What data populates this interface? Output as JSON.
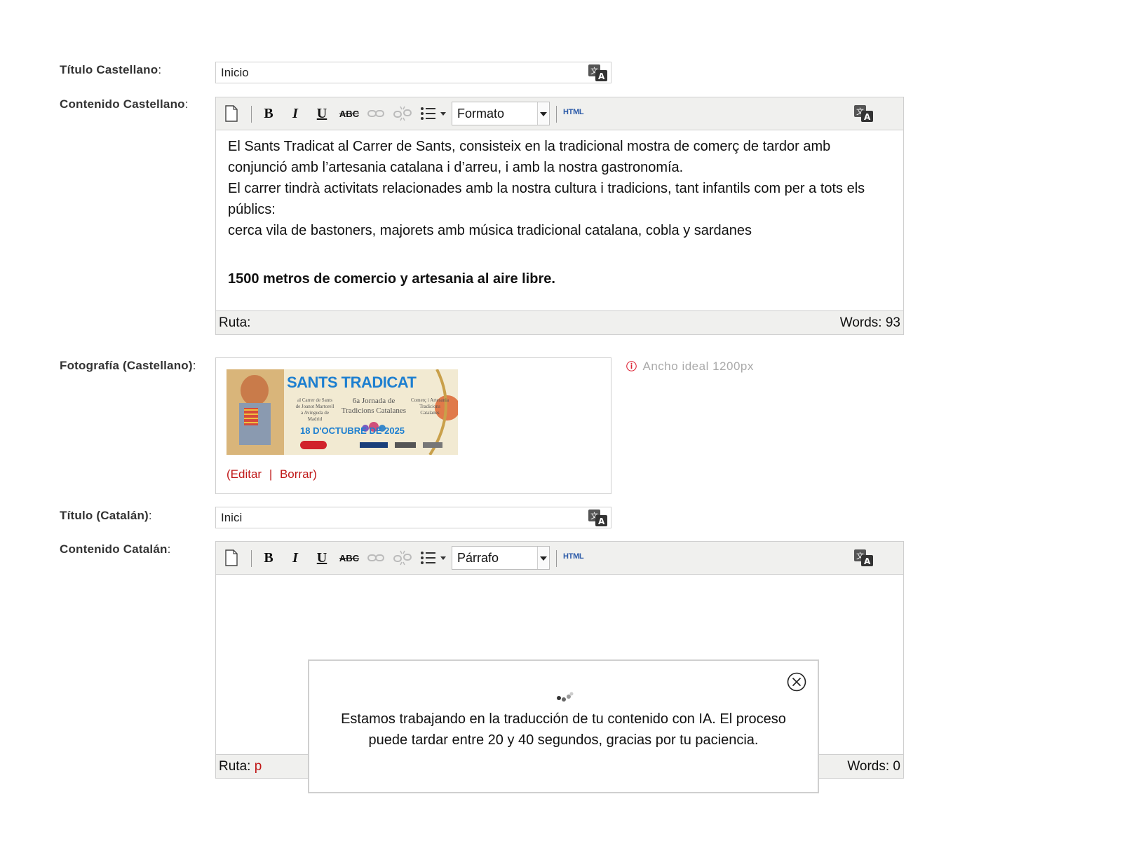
{
  "fields": {
    "titulo_castellano": {
      "label": "Título Castellano",
      "value": "Inicio"
    },
    "contenido_castellano": {
      "label": "Contenido Castellano",
      "format": "Formato",
      "paragraphs": [
        "El Sants Tradicat  al Carrer de Sants, consisteix en la tradicional mostra de comerç de tardor amb conjunció amb l’artesania catalana i d’arreu, i amb la nostra gastronomía.",
        "El carrer tindrà activitats relacionades amb la nostra cultura i tradicions, tant infantils com per a tots els públics:",
        "cerca vila de bastoners,  majorets amb música tradicional catalana, cobla y sardanes"
      ],
      "bold_line": "1500 metros de comercio y artesania al aire libre.",
      "ruta": "Ruta:",
      "words": "Words: 93"
    },
    "fotografia": {
      "label": "Fotografía (Castellano)",
      "banner": {
        "title": "SANTS TRADICAT",
        "left_text": [
          "al Carrer de Sants",
          "de Joanot Martorell",
          "a Avinguda de",
          "Madrid"
        ],
        "center_text": [
          "6a Jornada de",
          "Tradicions Catalanes"
        ],
        "right_text": [
          "Comerç i Artesania",
          "Tradicions",
          "Catalanes"
        ],
        "date": "18 D'OCTUBRE DE 2025"
      },
      "edit": "(Editar",
      "sep": "|",
      "delete": "Borrar)",
      "hint": "Ancho ideal 1200px"
    },
    "titulo_catalan": {
      "label": "Título (Catalán)",
      "value": "Inici"
    },
    "contenido_catalan": {
      "label": "Contenido Catalán",
      "format": "Párrafo",
      "ruta": "Ruta:",
      "ruta_tag": "p",
      "words": "Words: 0"
    }
  },
  "toolbar": {
    "html_label": "HTML"
  },
  "modal": {
    "message": "Estamos trabajando en la traducción de tu contenido con IA. El proceso puede tardar entre 20 y 40 segundos, gracias por tu paciencia."
  },
  "colors": {
    "link": "#c01818",
    "html_button": "#2b5aa8",
    "toolbar_bg": "#f0f0ee"
  },
  "icons": [
    "translate-icon",
    "new-document-icon",
    "bold-icon",
    "italic-icon",
    "underline-icon",
    "strikethrough-icon",
    "link-icon",
    "unlink-icon",
    "bullet-list-icon",
    "info-icon",
    "close-icon",
    "loading-spinner-icon"
  ]
}
